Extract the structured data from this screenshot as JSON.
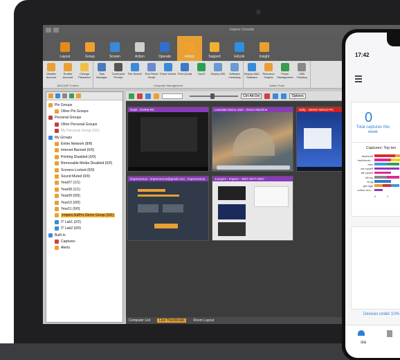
{
  "app": {
    "title": "Impero Console"
  },
  "tabs": [
    {
      "label": "Layout",
      "color": "#e58a1a"
    },
    {
      "label": "Group",
      "color": "#f0a030"
    },
    {
      "label": "Screen",
      "color": "#3a8ad8"
    },
    {
      "label": "Action",
      "color": "#cfcfcf"
    },
    {
      "label": "Operate",
      "color": "#2f6fcf"
    },
    {
      "label": "Admin",
      "color": "#f4a030"
    },
    {
      "label": "Support",
      "color": "#f0b030"
    },
    {
      "label": "EdLink",
      "color": "#2f8fe0"
    },
    {
      "label": "Insight",
      "color": "#e8a030"
    }
  ],
  "ribbon": {
    "groups": [
      {
        "caption": "AD/LDAP Control",
        "buttons": [
          {
            "label": "Disable Account",
            "color": "#e8a035"
          },
          {
            "label": "Enable Account",
            "color": "#e8a035"
          },
          {
            "label": "Change Password",
            "color": "#f0c040"
          }
        ]
      },
      {
        "caption": "Computer Management",
        "buttons": [
          {
            "label": "Task Manager",
            "color": "#4a7ab8"
          },
          {
            "label": "Command Prompt",
            "color": "#555555"
          },
          {
            "label": "File Search",
            "color": "#3a8ad8"
          },
          {
            "label": "Run Rmtcl Script",
            "color": "#6a8ad0"
          },
          {
            "label": "Event Viewer",
            "color": "#3a8ad8"
          },
          {
            "label": "Print Quota",
            "color": "#3a7ac8"
          },
          {
            "label": "YouID",
            "color": "#2aa050"
          },
          {
            "label": "Deploy MSI",
            "color": "#6a9ad0"
          },
          {
            "label": "Software Licensing",
            "color": "#6a9ad0"
          }
        ]
      },
      {
        "caption": "Admin Tools",
        "buttons": [
          {
            "label": "Deploy MAC Software",
            "color": "#3a8ad8"
          },
          {
            "label": "Resource Graphs",
            "color": "#e8a035"
          },
          {
            "label": "Power Management",
            "color": "#3a9a50"
          },
          {
            "label": "USB Tracking",
            "color": "#888888"
          }
        ]
      }
    ]
  },
  "tree": {
    "items": [
      {
        "label": "Pin Groups",
        "level": 0,
        "color": "#e8a035"
      },
      {
        "label": "Other Pin Groups",
        "level": 1,
        "color": "#e8a035"
      },
      {
        "label": "Personal Groups",
        "level": 0,
        "color": "#c04040"
      },
      {
        "label": "Other Personal Groups",
        "level": 1,
        "color": "#c04040"
      },
      {
        "label": "My Personal Group (0/0)",
        "level": 1,
        "color": "#c04040",
        "dim": true
      },
      {
        "label": "My Groups",
        "level": 0,
        "color": "#3a8ad8"
      },
      {
        "label": "Entire Network (8/8)",
        "level": 1,
        "color": "#e8a035"
      },
      {
        "label": "Internet Banned (0/0)",
        "level": 1,
        "color": "#e8a035"
      },
      {
        "label": "Printing Disabled (0/0)",
        "level": 1,
        "color": "#e8a035"
      },
      {
        "label": "Removable Media Disabled (0/0)",
        "level": 1,
        "color": "#e8a035"
      },
      {
        "label": "Screens Locked (0/0)",
        "level": 1,
        "color": "#e8a035"
      },
      {
        "label": "Sound Muted (0/0)",
        "level": 1,
        "color": "#e8a035"
      },
      {
        "label": "Year07 (1/1)",
        "level": 1,
        "color": "#e8a035"
      },
      {
        "label": "Year08 (1/1)",
        "level": 1,
        "color": "#e8a035"
      },
      {
        "label": "Year09 (0/0)",
        "level": 1,
        "color": "#e8a035"
      },
      {
        "label": "Year10 (0/0)",
        "level": 1,
        "color": "#e8a035"
      },
      {
        "label": "Year11 (0/0)",
        "level": 1,
        "color": "#e8a035"
      },
      {
        "label": "Impero EdPro Demo Group (5/5)",
        "level": 1,
        "color": "#e8a035",
        "selected": true
      },
      {
        "label": "IT Lab1 (2/2)",
        "level": 1,
        "color": "#3a8ad8"
      },
      {
        "label": "IT Lab2 (0/0)",
        "level": 1,
        "color": "#3a8ad8"
      },
      {
        "label": "Built In",
        "level": 0,
        "color": "#3a8ad8"
      },
      {
        "label": "Captures",
        "level": 1,
        "color": "#d04040"
      },
      {
        "label": "Alerts",
        "level": 1,
        "color": "#f0a030"
      }
    ]
  },
  "viewer": {
    "options_label": "Options",
    "thumbs": [
      {
        "caption": "Dvpk - DVEM-RC",
        "bar": "#8a3ab8"
      },
      {
        "caption": "Lewsolar Demo User - Demo Machine",
        "bar": "#8a3ab8"
      },
      {
        "caption": "Sally - DEMO-WIN10-PC",
        "bar": "#d02020"
      },
      {
        "caption": "impreroenus - impreroenus@gmail.com - impreroenus",
        "bar": "#8a3ab8"
      },
      {
        "caption": "Jonquim - Impero - 3007-3077-2007",
        "bar": "#8a3ab8"
      }
    ],
    "slider_text": "Ctrl-Alt-Del",
    "bottom_tabs": [
      "Computer List",
      "Live Thumbnails",
      "Room Layout"
    ]
  },
  "phone": {
    "time": "17:42",
    "captures_count": "0",
    "captures_label": "Total captures this week",
    "chart_title": "Captures: Top ten",
    "devices_label": "Devices under 10%",
    "nav_label": "sta"
  },
  "chart_data": {
    "type": "bar",
    "title": "Captures: Top ten",
    "categories": [
      "facebook",
      "toothbrush...",
      "cam",
      "cut myself",
      "kill myself",
      "kill my",
      "Drug",
      "get high",
      "cotton woo..."
    ],
    "series": [
      {
        "name": "",
        "values": [
          5,
          4,
          3,
          3,
          2,
          3,
          2,
          3,
          1
        ]
      }
    ],
    "series_colors": [
      [
        "#d43030",
        "#e8a035"
      ],
      [
        "#e02a90",
        "#f0d020"
      ],
      [
        "#3a9ad8",
        "#3aa050"
      ],
      [
        "#8a3ab8"
      ],
      [
        "#e02a90"
      ],
      [
        "#888888",
        "#e02a90"
      ],
      [
        "#2a7ad0"
      ],
      [
        "#e8a035",
        "#d43030",
        "#3a9ad8"
      ],
      [
        "#8a3ab8"
      ]
    ],
    "xlim": [
      0,
      5
    ],
    "x_ticks": [
      "0",
      "1"
    ]
  }
}
